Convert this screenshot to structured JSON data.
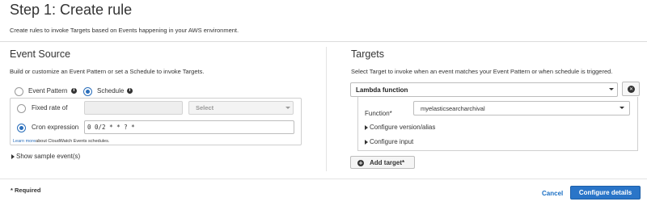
{
  "page": {
    "title": "Step 1: Create rule",
    "description": "Create rules to invoke Targets based on Events happening in your AWS environment."
  },
  "event_source": {
    "title": "Event Source",
    "description": "Build or customize an Event Pattern or set a Schedule to invoke Targets.",
    "mode_options": [
      {
        "label": "Event Pattern",
        "selected": false
      },
      {
        "label": "Schedule",
        "selected": true
      }
    ],
    "schedule": {
      "fixed_rate_label": "Fixed rate of",
      "fixed_rate_value": "",
      "unit_select_label": "Select",
      "cron_label": "Cron expression",
      "cron_value": "0 0/2 * * ? *",
      "selected": "cron",
      "learn_more_link": "Learn more",
      "learn_more_text": "about CloudWatch Events schedules."
    },
    "show_sample_label": "Show sample event(s)"
  },
  "targets": {
    "title": "Targets",
    "description": "Select Target to invoke when an event matches your Event Pattern or when schedule is triggered.",
    "target_type": "Lambda function",
    "function_label": "Function*",
    "function_value": "myelasticsearcharchival",
    "configure_version_label": "Configure version/alias",
    "configure_input_label": "Configure input",
    "add_target_label": "Add target*"
  },
  "footer": {
    "required_note": "* Required",
    "cancel_label": "Cancel",
    "configure_details_label": "Configure details"
  },
  "colors": {
    "primary_button": "#2a75c8",
    "link": "#1a6fc4",
    "radio_selected": "#2a6ebb"
  }
}
